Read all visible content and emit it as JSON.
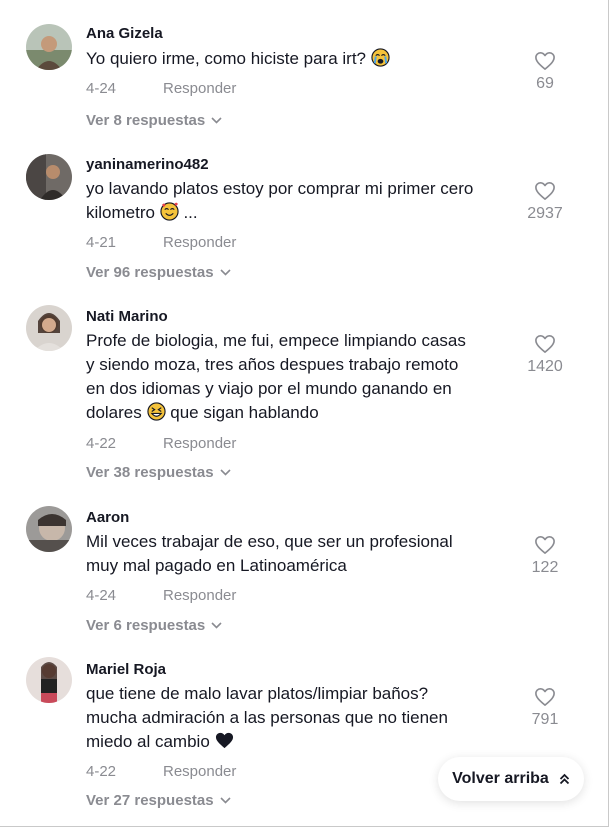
{
  "comments": [
    {
      "username": "Ana Gizela",
      "lines": [
        "Yo quiero irme, como hiciste para irt?"
      ],
      "emoji": "crying-face",
      "date": "4-24",
      "reply_label": "Responder",
      "likes": "69",
      "view_replies": "Ver 8 respuestas"
    },
    {
      "username": "yaninamerino482",
      "lines": [
        "yo lavando platos estoy por comprar mi primer cero",
        "kilometro",
        "..."
      ],
      "emoji": "smiling-hearts-face",
      "date": "4-21",
      "reply_label": "Responder",
      "likes": "2937",
      "view_replies": "Ver 96 respuestas"
    },
    {
      "username": "Nati Marino",
      "lines": [
        "Profe de biologia, me fui, empece limpiando casas",
        "y siendo moza, tres años despues trabajo remoto",
        "en dos idiomas y viajo por el mundo ganando en",
        "dolares",
        "que sigan hablando"
      ],
      "emoji": "grinning-squint-face",
      "date": "4-22",
      "reply_label": "Responder",
      "likes": "1420",
      "view_replies": "Ver 38 respuestas"
    },
    {
      "username": "Aaron",
      "lines": [
        "Mil veces trabajar de eso, que ser un profesional",
        "muy mal pagado en Latinoamérica"
      ],
      "date": "4-24",
      "reply_label": "Responder",
      "likes": "122",
      "view_replies": "Ver 6 respuestas"
    },
    {
      "username": "Mariel Roja",
      "lines": [
        "que tiene de malo lavar platos/limpiar baños?",
        "mucha admiración a las personas que no tienen",
        "miedo al cambio"
      ],
      "emoji": "black-heart",
      "date": "4-22",
      "reply_label": "Responder",
      "likes": "791",
      "view_replies": "Ver 27 respuestas"
    }
  ],
  "back_to_top": "Volver arriba",
  "icons": {
    "like": "heart-outline-icon",
    "expand": "chevron-down-icon",
    "back_to_top": "double-chevron-up-icon"
  },
  "colors": {
    "text": "#161823",
    "muted": "#8a8b91"
  }
}
